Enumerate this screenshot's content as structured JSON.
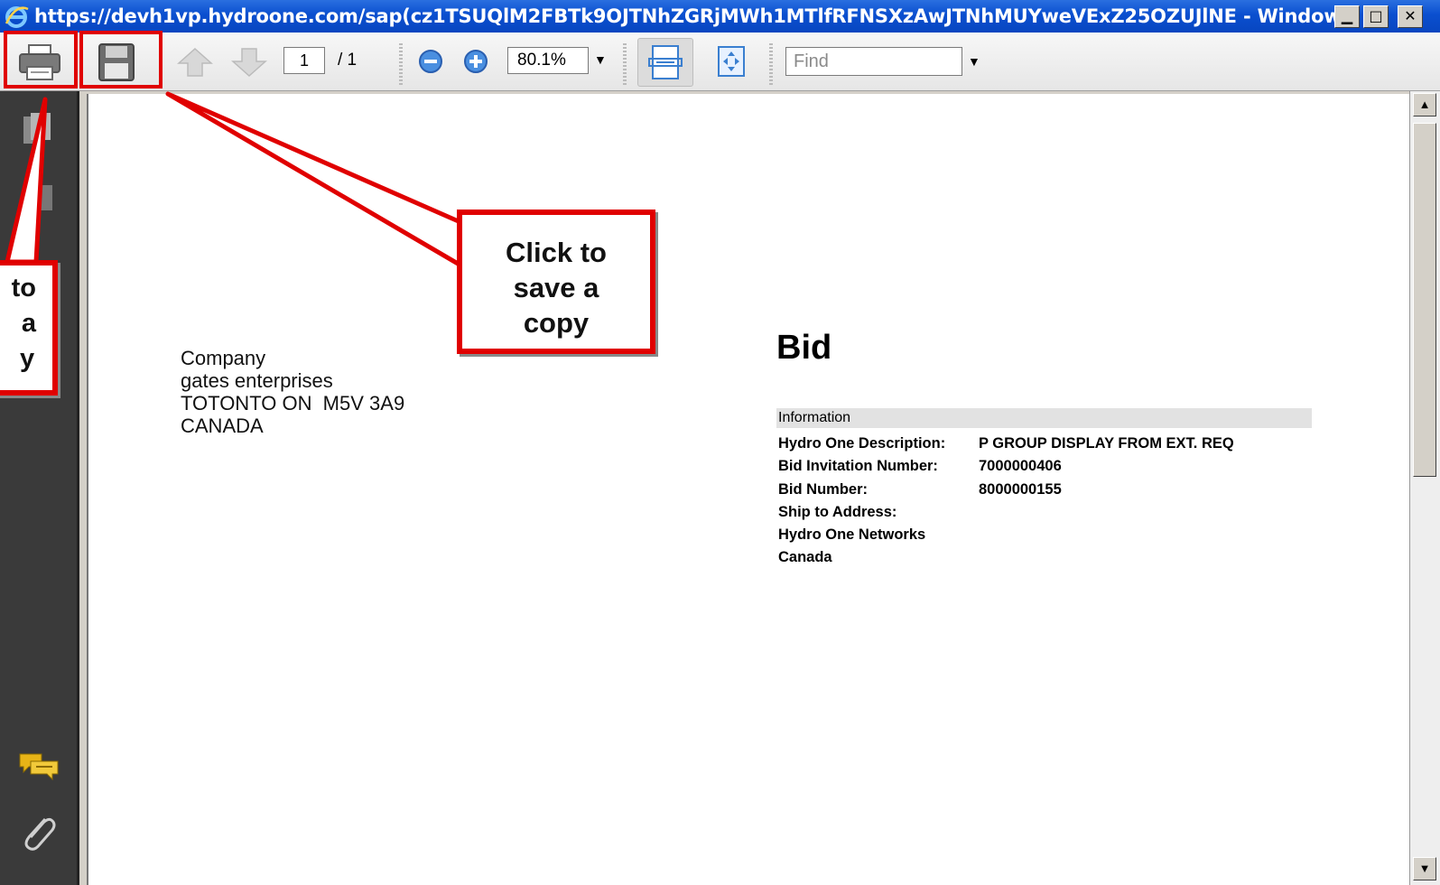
{
  "window": {
    "title": "https://devh1vp.hydroone.com/sap(cz1TSUQlM2FBTk9OJTNhZGRjMWh1MTlfRFNSXzAwJTNhMUYweVExZ25OZUJlNE - Windows ...",
    "controls": [
      "minimize",
      "maximize",
      "close"
    ]
  },
  "toolbar": {
    "page_current": "1",
    "page_total": "/ 1",
    "zoom": "80.1%",
    "find_placeholder": "Find"
  },
  "document": {
    "address_lines": [
      "Company",
      "gates enterprises",
      "TOTONTO ON  M5V 3A9",
      "CANADA"
    ],
    "title": "Bid",
    "info_header": "Information",
    "rows": [
      {
        "label": "Hydro One Description:",
        "value": "P GROUP DISPLAY FROM EXT. REQ"
      },
      {
        "label": "Bid Invitation Number:",
        "value": "7000000406"
      },
      {
        "label": "Bid Number:",
        "value": "8000000155"
      },
      {
        "label": "Ship to Address:",
        "value": ""
      },
      {
        "label": "Hydro One Networks",
        "value": ""
      },
      {
        "label": "Canada",
        "value": ""
      }
    ]
  },
  "callouts": {
    "save": [
      "Click to",
      "save a",
      "copy"
    ],
    "print_partial": [
      "to",
      "a",
      "y"
    ]
  },
  "colors": {
    "highlight": "#e00000",
    "title_bar": "#0a4fcf",
    "side_panel": "#3a3a3a"
  }
}
